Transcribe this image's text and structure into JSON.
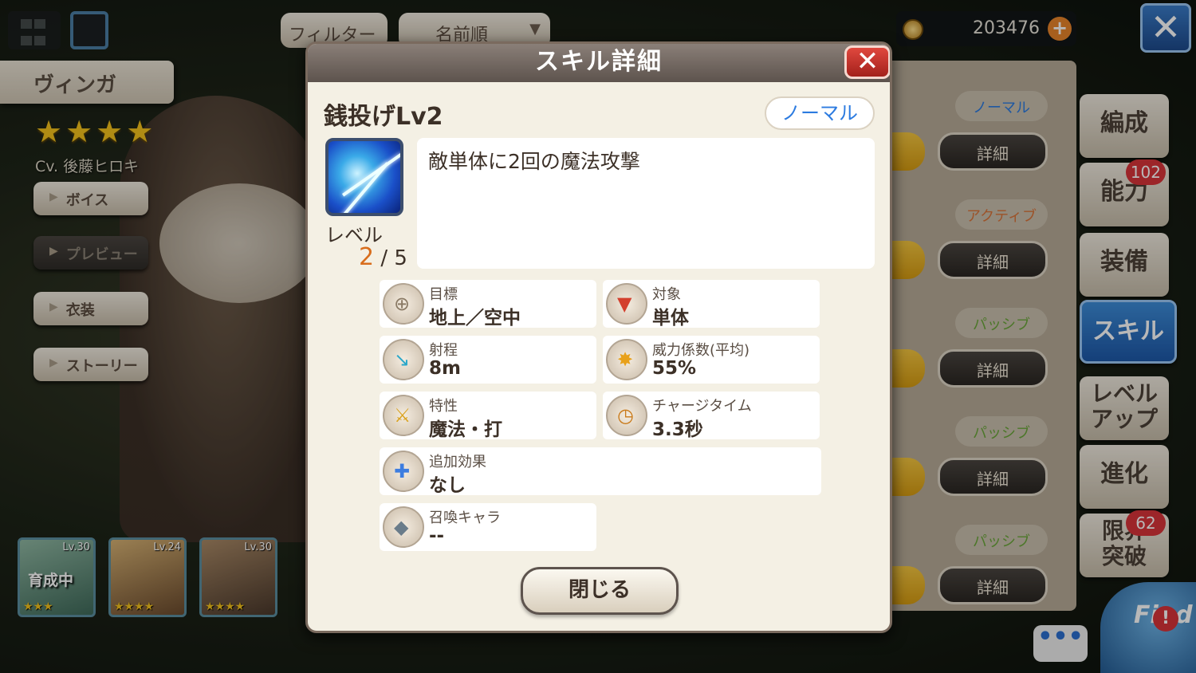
{
  "background": {
    "character_name": "ヴィンガ",
    "stars": "★★★★",
    "cv": "Cv. 後藤ヒロキ",
    "side_buttons": [
      "ボイス",
      "プレビュー",
      "衣装",
      "ストーリー"
    ],
    "filter_label": "フィルター",
    "sort_label": "名前順",
    "coins": "203476",
    "coin_plus": "+",
    "close_icon": "✕",
    "portraits": [
      {
        "level": "Lv.30",
        "stars": "★★★",
        "tag": "育成中"
      },
      {
        "level": "Lv.24",
        "stars": "★★★★",
        "tag": ""
      },
      {
        "level": "Lv.30",
        "stars": "★★★★",
        "tag": ""
      }
    ],
    "skills": [
      {
        "type": "ノーマル",
        "detail": "詳細"
      },
      {
        "type": "アクティブ",
        "detail": "詳細"
      },
      {
        "type": "パッシブ",
        "detail": "詳細"
      },
      {
        "type": "パッシブ",
        "detail": "詳細"
      },
      {
        "type": "パッシブ",
        "detail": "詳細"
      }
    ],
    "menu": [
      {
        "label": "編成",
        "badge": ""
      },
      {
        "label": "能力",
        "badge": "102"
      },
      {
        "label": "装備",
        "badge": ""
      },
      {
        "label": "スキル",
        "badge": ""
      },
      {
        "label_1": "レベル",
        "label_2": "アップ",
        "badge": ""
      },
      {
        "label": "進化",
        "badge": ""
      },
      {
        "label_1": "限界",
        "label_2": "突破",
        "badge": "62"
      }
    ],
    "chat": "•••",
    "find": "Find",
    "find_alert": "!"
  },
  "modal": {
    "title": "スキル詳細",
    "close_x": "✕",
    "skill_name": "銭投げLv2",
    "rank": "ノーマル",
    "level_label": "レベル",
    "level_current": "2",
    "level_max": "/ 5",
    "description": "敵単体に2回の魔法攻撃",
    "stats": {
      "target": {
        "label": "目標",
        "value": "地上／空中"
      },
      "scope": {
        "label": "対象",
        "value": "単体"
      },
      "range": {
        "label": "射程",
        "value": "8m"
      },
      "power": {
        "label": "威力係数(平均)",
        "value": "55%"
      },
      "attribute": {
        "label": "特性",
        "value": "魔法・打"
      },
      "charge": {
        "label": "チャージタイム",
        "value": "3.3秒"
      },
      "extra": {
        "label": "追加効果",
        "value": "なし"
      },
      "summon": {
        "label": "召喚キャラ",
        "value": "--"
      }
    },
    "close_button": "閉じる"
  }
}
